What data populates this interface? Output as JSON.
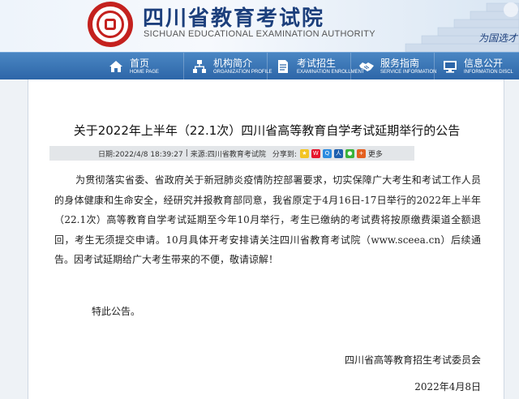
{
  "header": {
    "site_name_cn": "四川省教育考试院",
    "site_name_en": "SICHUAN EDUCATIONAL EXAMINATION AUTHORITY",
    "slogan": "为国选才"
  },
  "nav": [
    {
      "cn": "首页",
      "en": "HOME PAGE",
      "icon": "home-icon"
    },
    {
      "cn": "机构简介",
      "en": "ORGANIZATION PROFILE",
      "icon": "org-chart-icon"
    },
    {
      "cn": "考试招生",
      "en": "EXAMINATION ENROLLMENT",
      "icon": "exam-paper-icon"
    },
    {
      "cn": "服务指南",
      "en": "SERVICE INFORMATION",
      "icon": "handshake-icon"
    },
    {
      "cn": "信息公开",
      "en": "INFORMATION DISCL",
      "icon": "info-monitor-icon"
    }
  ],
  "article": {
    "title": "关于2022年上半年（22.1次）四川省高等教育自学考试延期举行的公告",
    "date": "日期:2022/4/8 18:39:27",
    "sep": "|",
    "source": "来源:四川省教育考试院",
    "share_label": "分享到:",
    "share_icons": [
      "qzone-icon",
      "weibo-icon",
      "qq-icon",
      "renren-icon",
      "wechat-icon",
      "plus-icon"
    ],
    "more": "更多",
    "body": "为贯彻落实省委、省政府关于新冠肺炎疫情防控部署要求，切实保障广大考生和考试工作人员的身体健康和生命安全，经研究并报教育部同意，我省原定于4月16日-17日举行的2022年上半年（22.1次）高等教育自学考试延期至今年10月举行，考生已缴纳的考试费将按原缴费渠道全额退回，考生无须提交申请。10月具体开考安排请关注四川省教育考试院（www.sceea.cn）后续通告。因考试延期给广大考生带来的不便，敬请谅解！",
    "notice": "特此公告。",
    "signer": "四川省高等教育招生考试委员会",
    "sign_date": "2022年4月8日"
  },
  "colors": {
    "nav_bg": "#2d66a8",
    "brand_red": "#c4211e",
    "brand_blue": "#1c3f7c"
  }
}
